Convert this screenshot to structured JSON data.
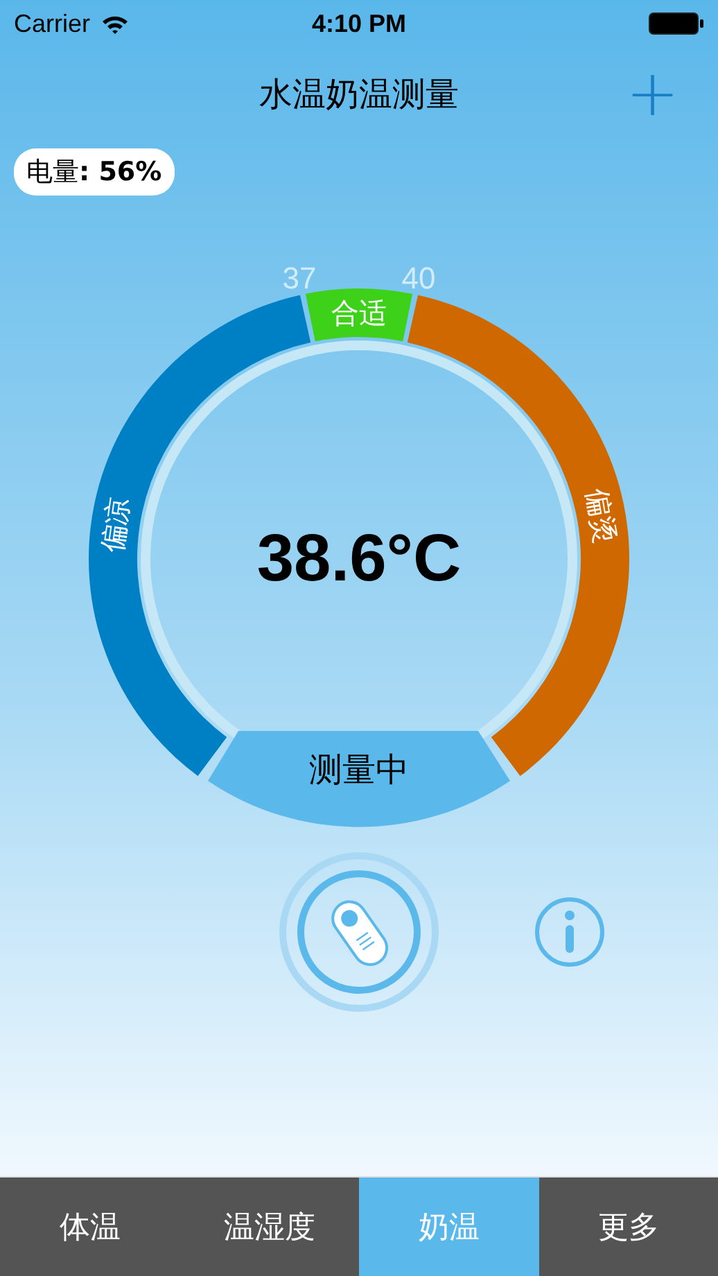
{
  "status_bar": {
    "carrier": "Carrier",
    "time": "4:10 PM"
  },
  "nav": {
    "title": "水温奶温测量",
    "add_label": "+"
  },
  "battery_badge": "电量**: 56%**",
  "gauge": {
    "segments": [
      {
        "label": "偏凉",
        "color": "#0080c4"
      },
      {
        "label": "合适",
        "color": "#3dd11a"
      },
      {
        "label": "偏烫",
        "color": "#d06800"
      }
    ],
    "ticks": [
      "37",
      "40"
    ],
    "reading": "38.6°C",
    "status": "测量中"
  },
  "tabs": [
    {
      "label": "体温",
      "selected": false
    },
    {
      "label": "温湿度",
      "selected": false
    },
    {
      "label": "奶温",
      "selected": true
    },
    {
      "label": "更多",
      "selected": false
    }
  ]
}
